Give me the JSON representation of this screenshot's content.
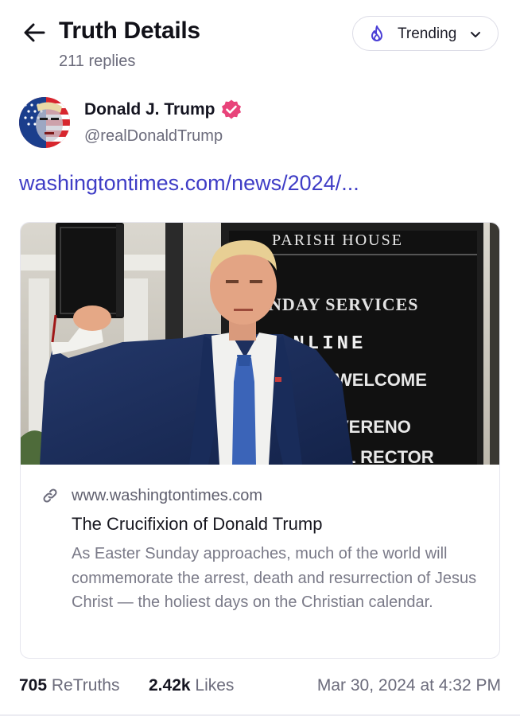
{
  "header": {
    "title": "Truth Details",
    "replies": "211 replies",
    "trending_label": "Trending"
  },
  "author": {
    "name": "Donald J. Trump",
    "handle": "@realDonaldTrump"
  },
  "post": {
    "link_text": "washingtontimes.com/news/2024/..."
  },
  "card": {
    "domain": "www.washingtontimes.com",
    "title": "The Crucifixion of Donald Trump",
    "description": "As Easter Sunday approaches, much of the world will commemorate the arrest, death and resurrection of Jesus Christ — the holiest days on the Christian calendar.",
    "sign_lines": [
      "PARISH HOUSE",
      "NDAY SERVICES",
      "ONLINE",
      "WELCOME",
      "VERENO",
      "L RECTOR"
    ]
  },
  "stats": {
    "retruths_count": "705",
    "retruths_label": "ReTruths",
    "likes_count": "2.42k",
    "likes_label": "Likes",
    "timestamp": "Mar 30, 2024 at 4:32 PM"
  },
  "colors": {
    "accent": "#3f3dc6",
    "verified": "#e8437a",
    "muted": "#6b6b7b"
  },
  "icons": [
    "back-arrow-icon",
    "flame-icon",
    "chevron-down-icon",
    "verified-badge-icon",
    "link-icon"
  ]
}
